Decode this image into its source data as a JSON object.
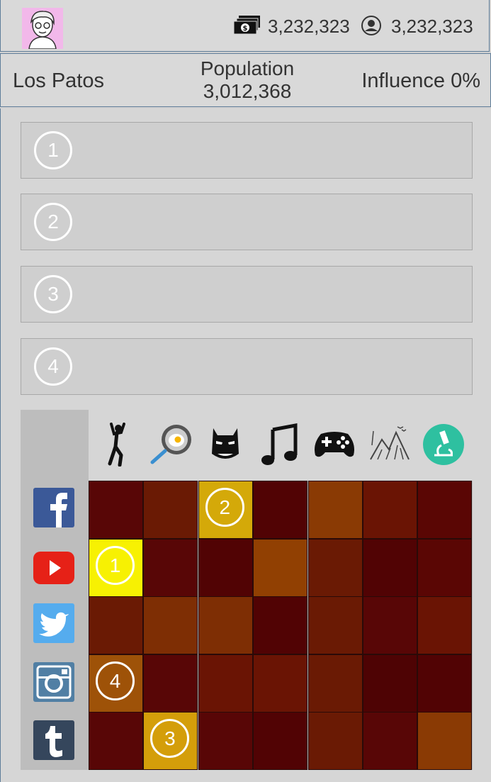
{
  "header": {
    "money": "3,232,323",
    "followers": "3,232,323",
    "money_icon": "cash-stack-icon",
    "followers_icon": "person-badge-icon"
  },
  "location": {
    "city": "Los Patos",
    "population_label": "Population",
    "population_value": "3,012,368",
    "influence": "Influence 0%"
  },
  "slots": [
    {
      "number": "1"
    },
    {
      "number": "2"
    },
    {
      "number": "3"
    },
    {
      "number": "4"
    }
  ],
  "categories": [
    "dance-icon",
    "cooking-icon",
    "superhero-icon",
    "music-icon",
    "gaming-icon",
    "nature-icon",
    "science-icon"
  ],
  "networks": [
    "facebook-icon",
    "youtube-icon",
    "twitter-icon",
    "instagram-icon",
    "tumblr-icon"
  ],
  "grid": [
    [
      "#580606",
      "#6a1a04",
      "#d4a909",
      "#510304",
      "#8a3a04",
      "#6a1404",
      "#5a0604"
    ],
    [
      "#f7f102",
      "#580606",
      "#510304",
      "#914002",
      "#6a1a04",
      "#510304",
      "#5a0604"
    ],
    [
      "#6a1a04",
      "#7e2e04",
      "#7e2e04",
      "#510304",
      "#6a1a04",
      "#580606",
      "#6a1404"
    ],
    [
      "#9e5208",
      "#580606",
      "#6a1404",
      "#6a1404",
      "#6a1a04",
      "#4e0304",
      "#510304"
    ],
    [
      "#580606",
      "#d49e0a",
      "#580606",
      "#510304",
      "#6a1a04",
      "#580606",
      "#8a3a04"
    ]
  ],
  "markers": [
    {
      "label": "2",
      "row": 0,
      "col": 2
    },
    {
      "label": "1",
      "row": 1,
      "col": 0
    },
    {
      "label": "4",
      "row": 3,
      "col": 0
    },
    {
      "label": "3",
      "row": 4,
      "col": 1
    }
  ]
}
